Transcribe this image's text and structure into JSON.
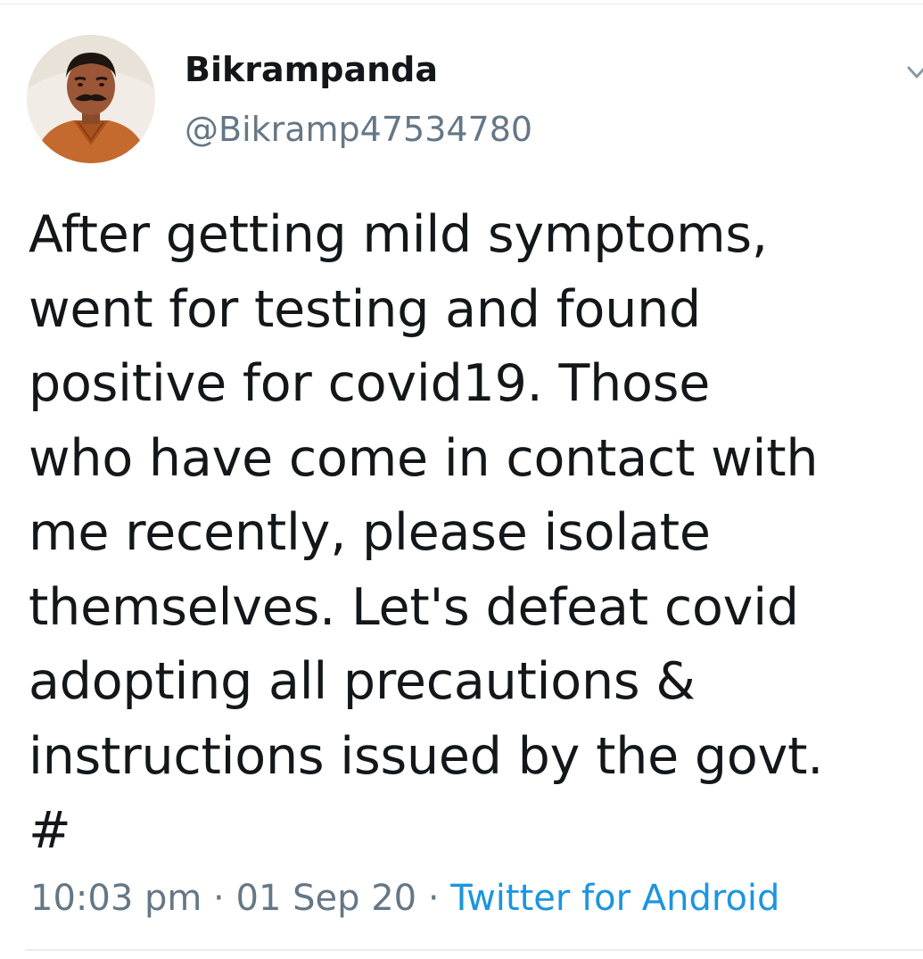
{
  "author": {
    "display_name": "Bikrampanda",
    "handle": "@Bikramp47534780",
    "avatar_icon": "profile-photo"
  },
  "tweet": {
    "text": "After getting mild symptoms,\nwent for testing and found\npositive for covid19. Those\nwho have come in contact with\nme recently, please isolate\nthemselves. Let's defeat covid\nadopting all precautions &\ninstructions issued by the govt.\n#",
    "time": "10:03 pm",
    "separator": " · ",
    "date": "01 Sep 20",
    "source": "Twitter for Android"
  },
  "icons": {
    "menu": "chevron-down-icon"
  },
  "colors": {
    "text_primary": "#14171a",
    "text_secondary": "#657786",
    "link": "#1b95e0",
    "divider": "#e6ecf0"
  }
}
